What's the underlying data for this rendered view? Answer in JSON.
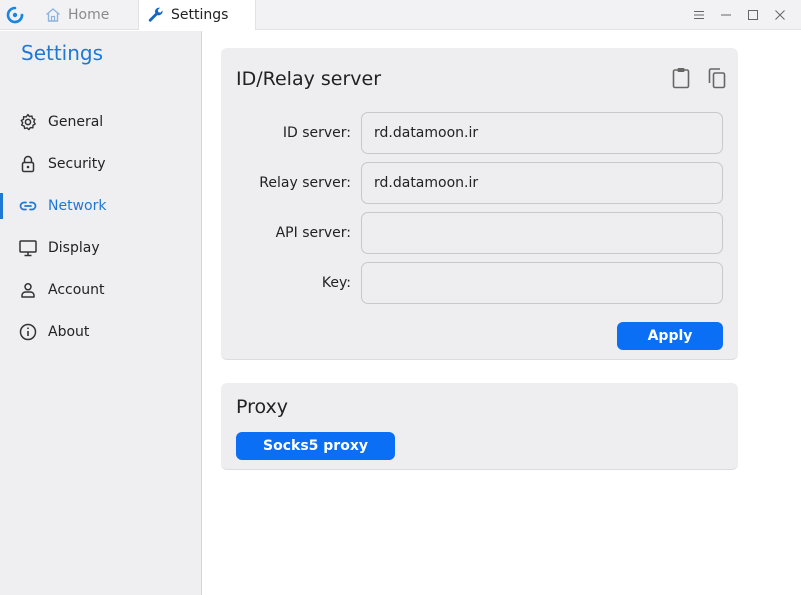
{
  "titlebar": {
    "tabs": [
      {
        "label": "Home",
        "icon": "home-icon"
      },
      {
        "label": "Settings",
        "icon": "wrench-icon"
      }
    ],
    "controls": [
      "menu-icon",
      "minimize-icon",
      "maximize-icon",
      "close-icon"
    ]
  },
  "sidebar": {
    "title": "Settings",
    "items": [
      {
        "label": "General",
        "icon": "gear-icon",
        "active": false
      },
      {
        "label": "Security",
        "icon": "lock-icon",
        "active": false
      },
      {
        "label": "Network",
        "icon": "link-icon",
        "active": true
      },
      {
        "label": "Display",
        "icon": "monitor-icon",
        "active": false
      },
      {
        "label": "Account",
        "icon": "user-icon",
        "active": false
      },
      {
        "label": "About",
        "icon": "info-icon",
        "active": false
      }
    ]
  },
  "relay": {
    "title": "ID/Relay server",
    "fields": [
      {
        "label": "ID server:",
        "value": "rd.datamoon.ir"
      },
      {
        "label": "Relay server:",
        "value": "rd.datamoon.ir"
      },
      {
        "label": "API server:",
        "value": ""
      },
      {
        "label": "Key:",
        "value": ""
      }
    ],
    "apply_label": "Apply"
  },
  "proxy": {
    "title": "Proxy",
    "socks_label": "Socks5 proxy"
  },
  "colors": {
    "accent": "#1d78d6",
    "button": "#0a6ff5"
  }
}
